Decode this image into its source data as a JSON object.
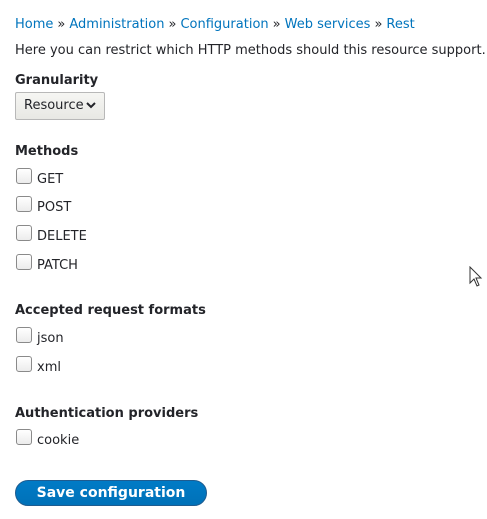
{
  "breadcrumb": {
    "items": [
      "Home",
      "Administration",
      "Configuration",
      "Web services",
      "Rest"
    ],
    "separator": "»"
  },
  "description": "Here you can restrict which HTTP methods should this resource support.",
  "granularity": {
    "label": "Granularity",
    "selected": "Resource"
  },
  "methods": {
    "label": "Methods",
    "options": [
      "GET",
      "POST",
      "DELETE",
      "PATCH"
    ]
  },
  "formats": {
    "label": "Accepted request formats",
    "options": [
      "json",
      "xml"
    ]
  },
  "auth": {
    "label": "Authentication providers",
    "options": [
      "cookie"
    ]
  },
  "actions": {
    "save_label": "Save configuration"
  },
  "colors": {
    "link": "#0074bd",
    "button": "#0074bd",
    "text": "#232429"
  },
  "icons": {
    "select_arrow": "chevron-down-icon",
    "pointer": "mouse-cursor-icon"
  }
}
